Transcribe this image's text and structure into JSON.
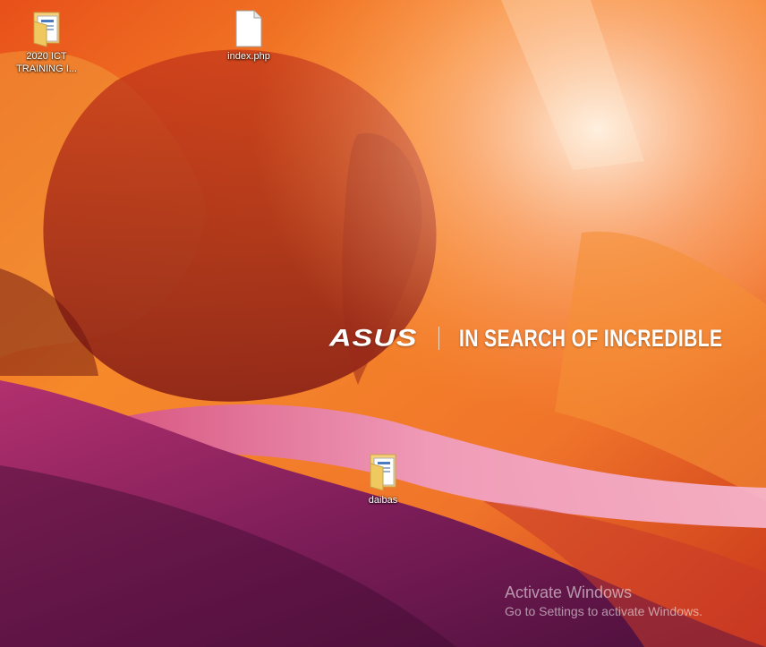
{
  "desktop": {
    "icons": [
      {
        "label": "2020 ICT TRAINING I...",
        "icon": "folder-with-documents-icon"
      },
      {
        "label": "index.php",
        "icon": "blank-file-icon"
      },
      {
        "label": "daibas",
        "icon": "folder-with-documents-icon"
      }
    ]
  },
  "wallpaper": {
    "brand_logo": "ASUS",
    "tagline": "IN SEARCH OF INCREDIBLE",
    "colors": {
      "orange": "#f07a1a",
      "red": "#b8261a",
      "magenta": "#a02a6a",
      "purple": "#5a1448"
    }
  },
  "watermark": {
    "title": "Activate Windows",
    "subtitle": "Go to Settings to activate Windows."
  }
}
